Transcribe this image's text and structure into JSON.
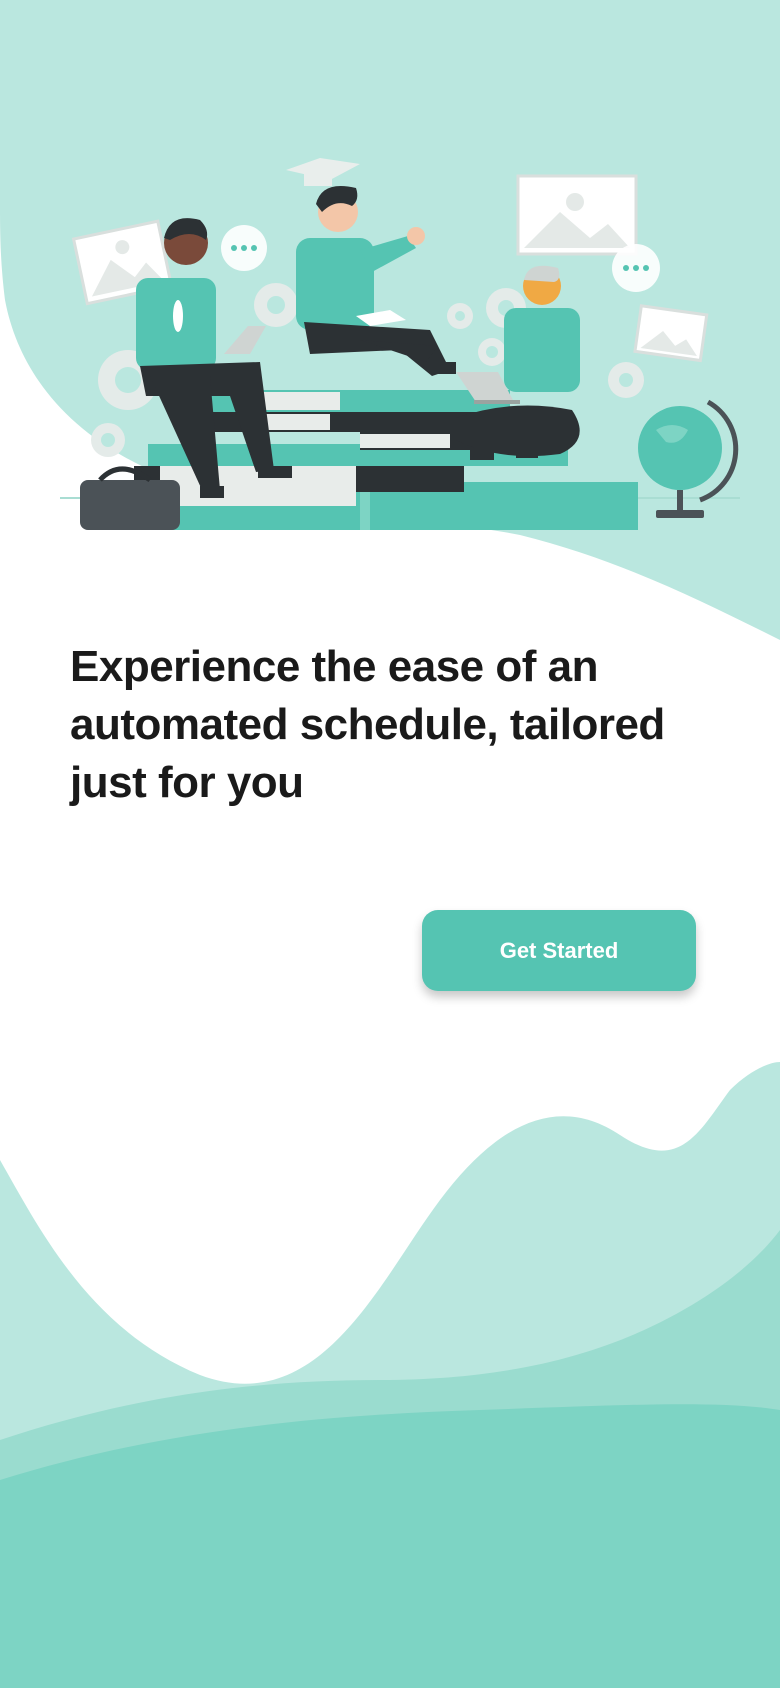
{
  "onboarding": {
    "headline": "Experience the ease of an automated schedule, tailored just for you",
    "cta_label": "Get Started"
  },
  "colors": {
    "accent": "#55c4b2",
    "wave_light": "#bae7df",
    "wave_mid": "#9adccf",
    "wave_dark": "#7dd4c4",
    "headline_text": "#1a1a1a",
    "button_text": "#ffffff"
  },
  "icons": [
    "graduation-cap-icon",
    "chat-bubble-icon",
    "image-frame-icon",
    "gear-icon",
    "laptop-icon",
    "globe-icon",
    "briefcase-icon"
  ]
}
